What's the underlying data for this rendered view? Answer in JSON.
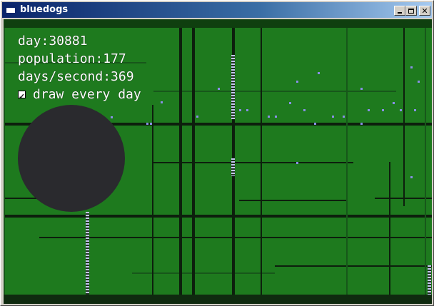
{
  "window": {
    "title": "bluedogs",
    "buttons": {
      "minimize": "minimize",
      "maximize": "maximize",
      "close": "close"
    }
  },
  "hud": {
    "day_label": "day:30881",
    "population_label": "population:177",
    "days_per_second_label": "days/second:369",
    "draw_every_day": {
      "label": "draw every day",
      "checked": true
    }
  },
  "colors": {
    "field": "#1e7a1e",
    "road": "#0d1f0d",
    "dog": "#8a8fe6",
    "blob": "#2a2a2e",
    "titlebar": "#0a246a"
  }
}
